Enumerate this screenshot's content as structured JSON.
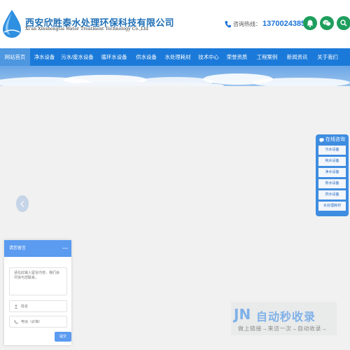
{
  "header": {
    "company_cn": "西安欣胜泰水处理环保科技有限公司",
    "company_en": "Xi'an Xinshengtai Water Treatment Technology Co.,Ltd",
    "hotline_label": "咨询热线：",
    "hotline_number": "13700243856",
    "social_icons": [
      "bell-icon",
      "wechat-icon",
      "search-icon"
    ]
  },
  "nav": {
    "items": [
      {
        "label": "网站首页",
        "active": true
      },
      {
        "label": "净水设备"
      },
      {
        "label": "污水/废水设备"
      },
      {
        "label": "循环水设备"
      },
      {
        "label": "供水设备"
      },
      {
        "label": "水处理耗材"
      },
      {
        "label": "技术中心"
      },
      {
        "label": "荣誉资质"
      },
      {
        "label": "工程案例"
      },
      {
        "label": "新闻资讯"
      },
      {
        "label": "关于我们"
      }
    ]
  },
  "service": {
    "title": "在线咨询",
    "items": [
      "污水设备",
      "纯水设备",
      "净水设备",
      "软水设备",
      "供水设备",
      "水处理耗材"
    ]
  },
  "message": {
    "title": "请您留言",
    "content_placeholder": "请在此输入留言内容，我们会尽快与您联系。",
    "name_placeholder": "姓名",
    "phone_placeholder": "电话（必填）",
    "submit_label": "提交"
  },
  "watermark": {
    "logo_text": "JN",
    "title": "自动秒收录",
    "slogan": "做上链接→来访一次→自动收录→"
  },
  "colors": {
    "nav": "#1b7ad9",
    "accent": "#1a73d9",
    "social": "#1d9e5c",
    "service": "#3f8de0",
    "message_header": "#5b9bf0"
  }
}
